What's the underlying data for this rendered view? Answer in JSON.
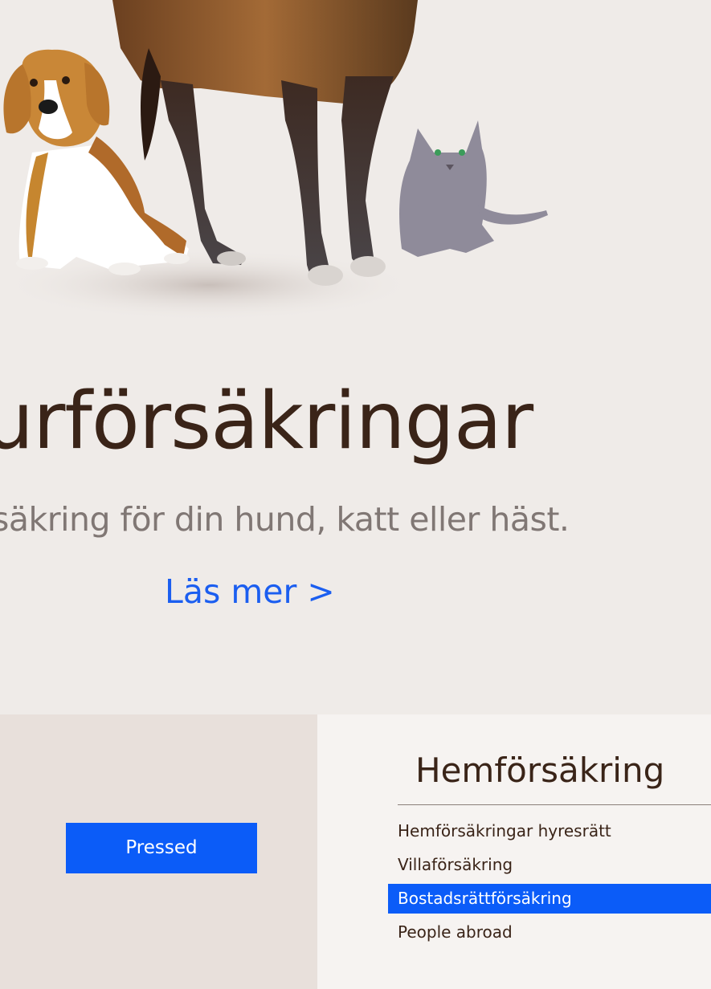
{
  "hero": {
    "title": "urförsäkringar",
    "subtitle": "säkring för din hund, katt eller häst.",
    "read_more": "Läs mer >",
    "image_semantics": [
      "dog-illustration",
      "horse-illustration",
      "cat-illustration"
    ]
  },
  "left_panel": {
    "button_label": "Pressed"
  },
  "menu": {
    "title": "Hemförsäkring",
    "items": [
      {
        "label": "Hemförsäkringar hyresrätt",
        "active": false
      },
      {
        "label": "Villaförsäkring",
        "active": false
      },
      {
        "label": "Bostadsrättförsäkring",
        "active": true
      },
      {
        "label": "People abroad",
        "active": false
      }
    ]
  },
  "colors": {
    "background": "#efebe8",
    "title_text": "#3a2418",
    "subtitle_text": "#807774",
    "link": "#1b5ef0",
    "accent": "#0b5cf8",
    "left_panel": "#e8e0db",
    "right_panel": "#f6f3f1"
  }
}
